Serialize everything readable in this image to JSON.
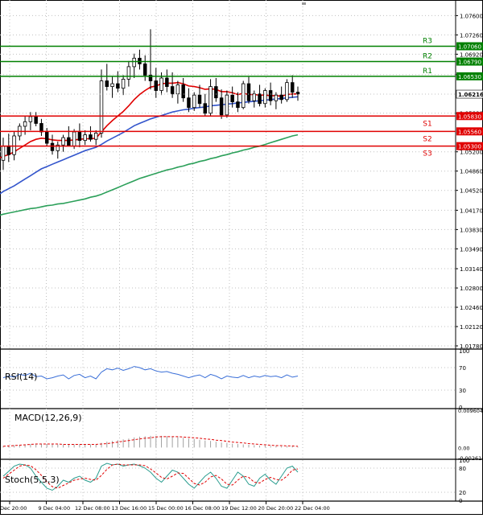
{
  "chart_data": [
    {
      "type": "candlestick",
      "title": "",
      "yaxis_ticks": [
        "1.07600",
        "1.07260",
        "1.06920",
        "1.06560",
        "1.06216",
        "1.05880",
        "1.05200",
        "1.04860",
        "1.04520",
        "1.04170",
        "1.03830",
        "1.03490",
        "1.03140",
        "1.02800",
        "1.02460",
        "1.02120",
        "1.01780"
      ],
      "ylim": [
        1.0178,
        1.0779
      ],
      "x_tick_labels": [
        "Dec 20:00",
        "9 Dec 04:00",
        "12 Dec 08:00",
        "13 Dec 16:00",
        "15 Dec 00:00",
        "16 Dec 08:00",
        "19 Dec 12:00",
        "20 Dec 20:00",
        "22 Dec 04:00"
      ],
      "current_price": "1.06216",
      "levels": [
        {
          "name": "R3",
          "value": 1.0706,
          "label": "1.07060",
          "color": "#008000"
        },
        {
          "name": "R2",
          "value": 1.0679,
          "label": "1.06790",
          "color": "#008000"
        },
        {
          "name": "R1",
          "value": 1.0653,
          "label": "1.06530",
          "color": "#008000"
        },
        {
          "name": "S1",
          "value": 1.0583,
          "label": "1.05830",
          "color": "#e00000"
        },
        {
          "name": "S2",
          "value": 1.0556,
          "label": "1.05560",
          "color": "#e00000"
        },
        {
          "name": "S3",
          "value": 1.053,
          "label": "1.05300",
          "color": "#e00000"
        }
      ],
      "candles": [
        {
          "o": 1.0505,
          "h": 1.0545,
          "l": 1.0488,
          "c": 1.053
        },
        {
          "o": 1.053,
          "h": 1.0552,
          "l": 1.0502,
          "c": 1.0515
        },
        {
          "o": 1.0515,
          "h": 1.0555,
          "l": 1.0505,
          "c": 1.0548
        },
        {
          "o": 1.0548,
          "h": 1.057,
          "l": 1.054,
          "c": 1.0565
        },
        {
          "o": 1.0565,
          "h": 1.0582,
          "l": 1.055,
          "c": 1.0573
        },
        {
          "o": 1.0573,
          "h": 1.059,
          "l": 1.0558,
          "c": 1.0582
        },
        {
          "o": 1.0582,
          "h": 1.059,
          "l": 1.0565,
          "c": 1.057
        },
        {
          "o": 1.057,
          "h": 1.0578,
          "l": 1.0548,
          "c": 1.0555
        },
        {
          "o": 1.0555,
          "h": 1.0562,
          "l": 1.053,
          "c": 1.0535
        },
        {
          "o": 1.0535,
          "h": 1.055,
          "l": 1.0515,
          "c": 1.0522
        },
        {
          "o": 1.0522,
          "h": 1.0538,
          "l": 1.0508,
          "c": 1.0532
        },
        {
          "o": 1.0532,
          "h": 1.055,
          "l": 1.052,
          "c": 1.0545
        },
        {
          "o": 1.0545,
          "h": 1.0565,
          "l": 1.0535,
          "c": 1.053
        },
        {
          "o": 1.053,
          "h": 1.056,
          "l": 1.0525,
          "c": 1.0555
        },
        {
          "o": 1.0555,
          "h": 1.057,
          "l": 1.0528,
          "c": 1.054
        },
        {
          "o": 1.054,
          "h": 1.0558,
          "l": 1.0532,
          "c": 1.055
        },
        {
          "o": 1.055,
          "h": 1.0565,
          "l": 1.0538,
          "c": 1.0542
        },
        {
          "o": 1.0542,
          "h": 1.0558,
          "l": 1.0532,
          "c": 1.0553
        },
        {
          "o": 1.0553,
          "h": 1.0665,
          "l": 1.0545,
          "c": 1.0645
        },
        {
          "o": 1.0645,
          "h": 1.0675,
          "l": 1.0628,
          "c": 1.0635
        },
        {
          "o": 1.0635,
          "h": 1.0652,
          "l": 1.0615,
          "c": 1.064
        },
        {
          "o": 1.064,
          "h": 1.0662,
          "l": 1.0625,
          "c": 1.0632
        },
        {
          "o": 1.0632,
          "h": 1.0655,
          "l": 1.062,
          "c": 1.0648
        },
        {
          "o": 1.0648,
          "h": 1.068,
          "l": 1.0635,
          "c": 1.067
        },
        {
          "o": 1.067,
          "h": 1.0693,
          "l": 1.065,
          "c": 1.0685
        },
        {
          "o": 1.0685,
          "h": 1.07,
          "l": 1.0665,
          "c": 1.0675
        },
        {
          "o": 1.0675,
          "h": 1.069,
          "l": 1.0645,
          "c": 1.0655
        },
        {
          "o": 1.0655,
          "h": 1.0736,
          "l": 1.063,
          "c": 1.0645
        },
        {
          "o": 1.0645,
          "h": 1.0668,
          "l": 1.0615,
          "c": 1.0628
        },
        {
          "o": 1.0628,
          "h": 1.066,
          "l": 1.062,
          "c": 1.065
        },
        {
          "o": 1.065,
          "h": 1.0665,
          "l": 1.0625,
          "c": 1.0635
        },
        {
          "o": 1.0635,
          "h": 1.066,
          "l": 1.0615,
          "c": 1.0622
        },
        {
          "o": 1.0622,
          "h": 1.0645,
          "l": 1.0605,
          "c": 1.0638
        },
        {
          "o": 1.0638,
          "h": 1.065,
          "l": 1.0608,
          "c": 1.0615
        },
        {
          "o": 1.0615,
          "h": 1.0632,
          "l": 1.059,
          "c": 1.0598
        },
        {
          "o": 1.0598,
          "h": 1.0625,
          "l": 1.0592,
          "c": 1.062
        },
        {
          "o": 1.062,
          "h": 1.0638,
          "l": 1.0598,
          "c": 1.0605
        },
        {
          "o": 1.0605,
          "h": 1.0622,
          "l": 1.0582,
          "c": 1.0588
        },
        {
          "o": 1.0588,
          "h": 1.0648,
          "l": 1.0582,
          "c": 1.0635
        },
        {
          "o": 1.0635,
          "h": 1.065,
          "l": 1.0608,
          "c": 1.0615
        },
        {
          "o": 1.0615,
          "h": 1.063,
          "l": 1.0578,
          "c": 1.0585
        },
        {
          "o": 1.0585,
          "h": 1.0628,
          "l": 1.058,
          "c": 1.062
        },
        {
          "o": 1.062,
          "h": 1.0635,
          "l": 1.0598,
          "c": 1.0608
        },
        {
          "o": 1.0608,
          "h": 1.0625,
          "l": 1.059,
          "c": 1.0598
        },
        {
          "o": 1.0598,
          "h": 1.0645,
          "l": 1.0595,
          "c": 1.064
        },
        {
          "o": 1.064,
          "h": 1.0652,
          "l": 1.0605,
          "c": 1.061
        },
        {
          "o": 1.061,
          "h": 1.0628,
          "l": 1.0598,
          "c": 1.0622
        },
        {
          "o": 1.0622,
          "h": 1.0638,
          "l": 1.06,
          "c": 1.0605
        },
        {
          "o": 1.0605,
          "h": 1.0632,
          "l": 1.0598,
          "c": 1.0628
        },
        {
          "o": 1.0628,
          "h": 1.0642,
          "l": 1.0602,
          "c": 1.061
        },
        {
          "o": 1.061,
          "h": 1.0625,
          "l": 1.0595,
          "c": 1.062
        },
        {
          "o": 1.062,
          "h": 1.0635,
          "l": 1.0605,
          "c": 1.0612
        },
        {
          "o": 1.0612,
          "h": 1.0648,
          "l": 1.0608,
          "c": 1.0642
        },
        {
          "o": 1.0642,
          "h": 1.0655,
          "l": 1.0615,
          "c": 1.0625
        },
        {
          "o": 1.0625,
          "h": 1.0635,
          "l": 1.061,
          "c": 1.0622
        }
      ],
      "moving_averages": [
        {
          "color": "#e00000",
          "values": [
            1.0512,
            1.0515,
            1.052,
            1.0526,
            1.0532,
            1.0538,
            1.0542,
            1.0544,
            1.0543,
            1.0541,
            1.054,
            1.054,
            1.054,
            1.0541,
            1.0542,
            1.0543,
            1.0543,
            1.0544,
            1.0555,
            1.0566,
            1.0575,
            1.0583,
            1.0591,
            1.0601,
            1.0612,
            1.0621,
            1.0628,
            1.0634,
            1.0636,
            1.064,
            1.0641,
            1.0641,
            1.0642,
            1.064,
            1.0636,
            1.0635,
            1.0633,
            1.063,
            1.0631,
            1.063,
            1.0626,
            1.0626,
            1.0624,
            1.0621,
            1.0623,
            1.0621,
            1.0621,
            1.062,
            1.062,
            1.0619,
            1.0619,
            1.0618,
            1.0621,
            1.0622,
            1.0622
          ]
        },
        {
          "color": "#3355cc",
          "values": [
            1.045,
            1.0455,
            1.046,
            1.0466,
            1.0472,
            1.0478,
            1.0484,
            1.049,
            1.0494,
            1.0498,
            1.0502,
            1.0506,
            1.051,
            1.0514,
            1.0518,
            1.0522,
            1.0525,
            1.0528,
            1.0533,
            1.0539,
            1.0544,
            1.0549,
            1.0554,
            1.056,
            1.0566,
            1.057,
            1.0574,
            1.0578,
            1.0581,
            1.0584,
            1.0587,
            1.059,
            1.0592,
            1.0594,
            1.0595,
            1.0597,
            1.0598,
            1.0599,
            1.0601,
            1.0602,
            1.0603,
            1.0604,
            1.0605,
            1.0606,
            1.0607,
            1.0608,
            1.0609,
            1.061,
            1.0611,
            1.0612,
            1.0613,
            1.0614,
            1.0615,
            1.0616,
            1.0617
          ]
        },
        {
          "color": "#2ca05a",
          "values": [
            1.041,
            1.0412,
            1.0414,
            1.0416,
            1.0418,
            1.042,
            1.0421,
            1.0423,
            1.0425,
            1.0426,
            1.0428,
            1.0429,
            1.0431,
            1.0433,
            1.0435,
            1.0437,
            1.044,
            1.0442,
            1.0445,
            1.0449,
            1.0453,
            1.0457,
            1.0461,
            1.0465,
            1.0469,
            1.0473,
            1.0476,
            1.0479,
            1.0482,
            1.0485,
            1.0488,
            1.049,
            1.0493,
            1.0495,
            1.0498,
            1.05,
            1.0503,
            1.0505,
            1.0508,
            1.051,
            1.0513,
            1.0515,
            1.0518,
            1.052,
            1.0523,
            1.0525,
            1.0528,
            1.053,
            1.0533,
            1.0536,
            1.0539,
            1.0542,
            1.0545,
            1.0548,
            1.055
          ]
        }
      ]
    },
    {
      "type": "line",
      "indicator": "RSI(14)",
      "yaxis_ticks": [
        "100",
        "70",
        "30",
        "0"
      ],
      "ylim": [
        0,
        100
      ],
      "levels": [
        70,
        30
      ],
      "series": [
        {
          "color": "#3a6fd8",
          "values": [
            52,
            55,
            53,
            58,
            56,
            60,
            54,
            55,
            50,
            52,
            55,
            57,
            50,
            56,
            58,
            52,
            55,
            50,
            62,
            68,
            66,
            69,
            65,
            68,
            72,
            70,
            66,
            68,
            64,
            62,
            63,
            60,
            58,
            55,
            52,
            55,
            57,
            52,
            58,
            55,
            50,
            55,
            53,
            52,
            56,
            52,
            55,
            53,
            56,
            54,
            55,
            52,
            57,
            53,
            55
          ]
        }
      ]
    },
    {
      "type": "bar",
      "indicator": "MACD(12,26,9)",
      "yaxis_ticks": [
        "0.009604",
        "0.00",
        "-0.002616"
      ],
      "ylim": [
        -0.002616,
        0.009604
      ],
      "histogram": [
        0.0004,
        0.0005,
        0.0006,
        0.0007,
        0.0008,
        0.0009,
        0.001,
        0.001,
        0.0009,
        0.0008,
        0.0008,
        0.0008,
        0.0008,
        0.0008,
        0.0008,
        0.0008,
        0.0008,
        0.0008,
        0.0012,
        0.0015,
        0.0017,
        0.0019,
        0.0021,
        0.0023,
        0.0026,
        0.0028,
        0.0029,
        0.003,
        0.003,
        0.003,
        0.0029,
        0.0028,
        0.0027,
        0.0025,
        0.0023,
        0.0022,
        0.002,
        0.0018,
        0.0017,
        0.0015,
        0.0013,
        0.0012,
        0.001,
        0.0009,
        0.0008,
        0.0007,
        0.0006,
        0.0005,
        0.0005,
        0.0004,
        0.0004,
        0.0003,
        0.0003,
        0.0003,
        0.0002
      ],
      "signal": {
        "color": "#e00000",
        "values": [
          0.0003,
          0.0004,
          0.0005,
          0.0006,
          0.0007,
          0.0008,
          0.0009,
          0.0009,
          0.0009,
          0.0009,
          0.0009,
          0.0008,
          0.0008,
          0.0008,
          0.0008,
          0.0008,
          0.0008,
          0.0008,
          0.0009,
          0.001,
          0.0012,
          0.0014,
          0.0016,
          0.0018,
          0.002,
          0.0022,
          0.0024,
          0.0025,
          0.0027,
          0.0028,
          0.0028,
          0.0028,
          0.0028,
          0.0027,
          0.0026,
          0.0025,
          0.0024,
          0.0022,
          0.0021,
          0.0019,
          0.0018,
          0.0016,
          0.0014,
          0.0013,
          0.0012,
          0.001,
          0.0009,
          0.0008,
          0.0007,
          0.0006,
          0.0005,
          0.0005,
          0.0004,
          0.0004,
          0.0003
        ]
      }
    },
    {
      "type": "line",
      "indicator": "Stoch(5,5,3)",
      "yaxis_ticks": [
        "100",
        "80",
        "20",
        "0"
      ],
      "ylim": [
        0,
        100
      ],
      "levels": [
        80,
        20
      ],
      "series": [
        {
          "color": "#2a9d8f",
          "values": [
            60,
            72,
            85,
            90,
            88,
            80,
            60,
            45,
            30,
            25,
            35,
            50,
            45,
            55,
            60,
            50,
            45,
            55,
            85,
            92,
            88,
            90,
            85,
            88,
            90,
            86,
            80,
            70,
            55,
            45,
            60,
            75,
            70,
            55,
            40,
            30,
            45,
            60,
            70,
            55,
            35,
            30,
            50,
            70,
            60,
            40,
            35,
            55,
            65,
            50,
            40,
            60,
            80,
            85,
            70
          ]
        },
        {
          "color": "#e00000",
          "values": [
            55,
            65,
            75,
            85,
            88,
            86,
            76,
            62,
            46,
            34,
            30,
            37,
            43,
            50,
            53,
            55,
            52,
            50,
            62,
            77,
            88,
            90,
            88,
            88,
            88,
            88,
            86,
            78,
            68,
            57,
            53,
            60,
            68,
            67,
            55,
            42,
            38,
            45,
            58,
            62,
            53,
            40,
            38,
            50,
            60,
            57,
            45,
            43,
            52,
            57,
            52,
            50,
            60,
            75,
            78
          ]
        }
      ]
    }
  ]
}
